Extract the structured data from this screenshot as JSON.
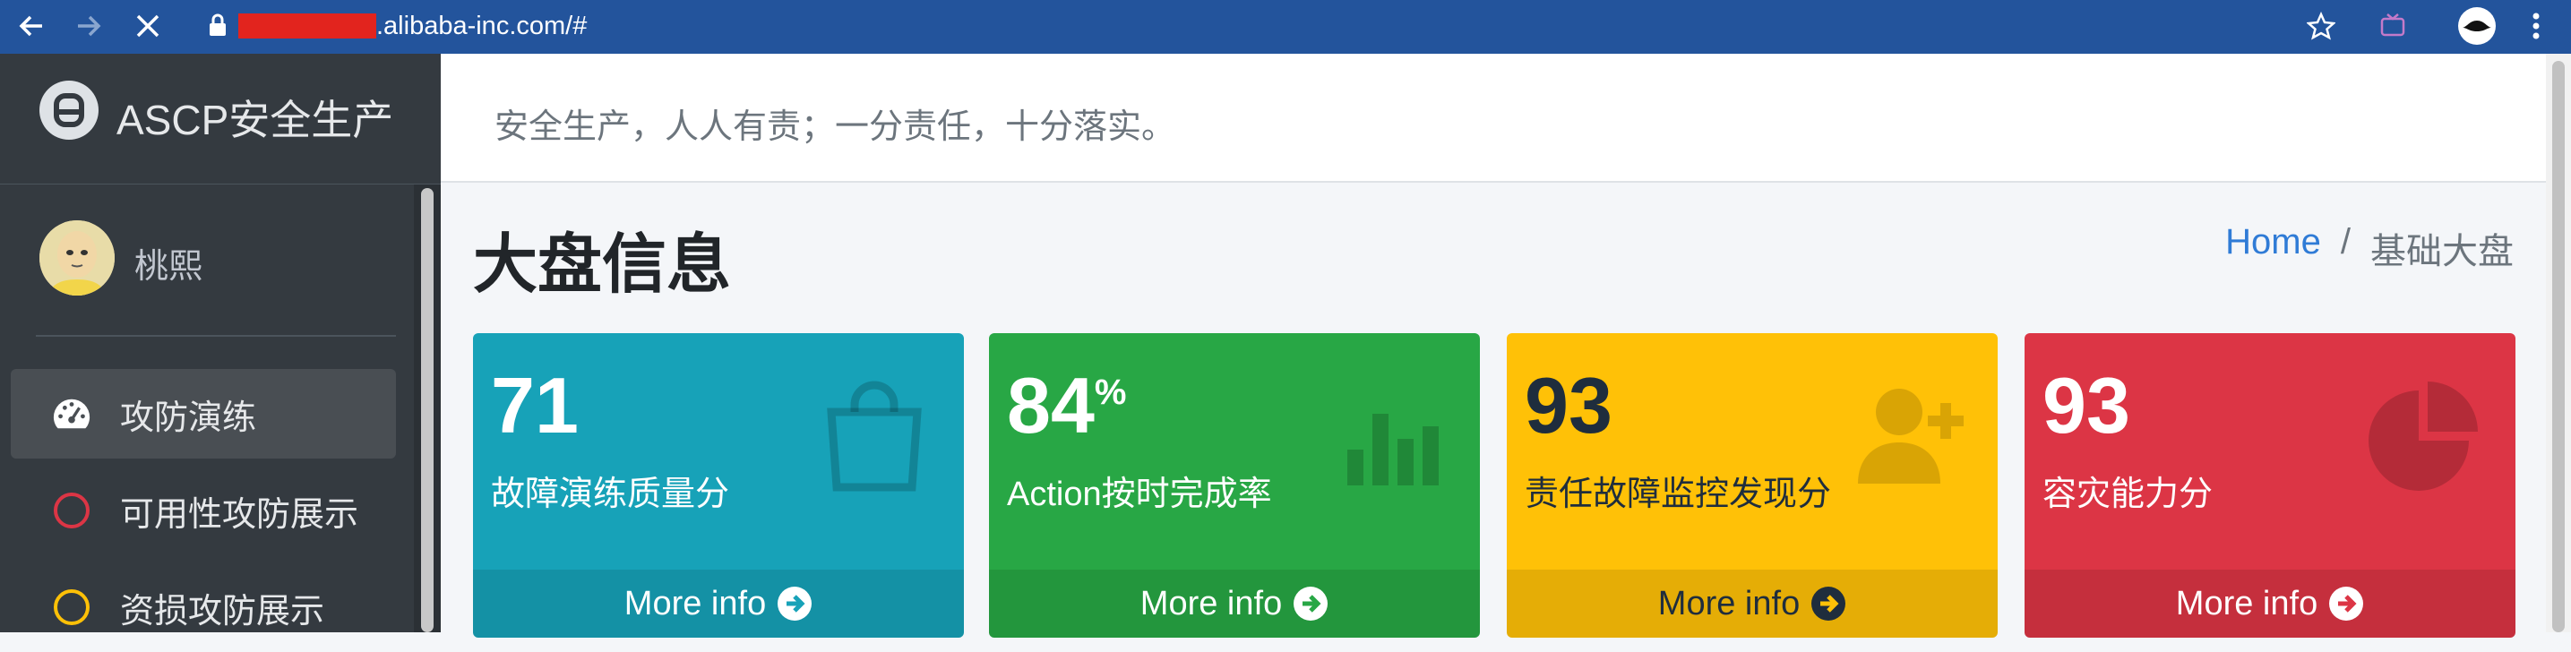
{
  "browser": {
    "url_visible": ".alibaba-inc.com/#"
  },
  "sidebar": {
    "brand": "ASCP安全生产",
    "user_name": "桃熙",
    "items": [
      {
        "label": "攻防演练",
        "icon": "dashboard-icon",
        "active": true
      },
      {
        "label": "可用性攻防展示",
        "icon": "circle-red-icon",
        "color": "#dc3545"
      },
      {
        "label": "资损攻防展示",
        "icon": "circle-yellow-icon",
        "color": "#ffc107"
      }
    ]
  },
  "header": {
    "slogan": "安全生产，人人有责；一分责任，十分落实。"
  },
  "page": {
    "title": "大盘信息",
    "breadcrumb": {
      "home": "Home",
      "separator": "/",
      "current": "基础大盘"
    }
  },
  "boxes": [
    {
      "value": "71",
      "suffix": "",
      "label": "故障演练质量分",
      "footer": "More info",
      "color": "#17a2b8",
      "icon": "shopping-bag-icon"
    },
    {
      "value": "84",
      "suffix": "%",
      "label": "Action按时完成率",
      "footer": "More info",
      "color": "#28a745",
      "icon": "bar-chart-icon"
    },
    {
      "value": "93",
      "suffix": "",
      "label": "责任故障监控发现分",
      "footer": "More info",
      "color": "#ffc107",
      "icon": "user-plus-icon"
    },
    {
      "value": "93",
      "suffix": "",
      "label": "容灾能力分",
      "footer": "More info",
      "color": "#dc3545",
      "icon": "pie-chart-icon"
    }
  ]
}
